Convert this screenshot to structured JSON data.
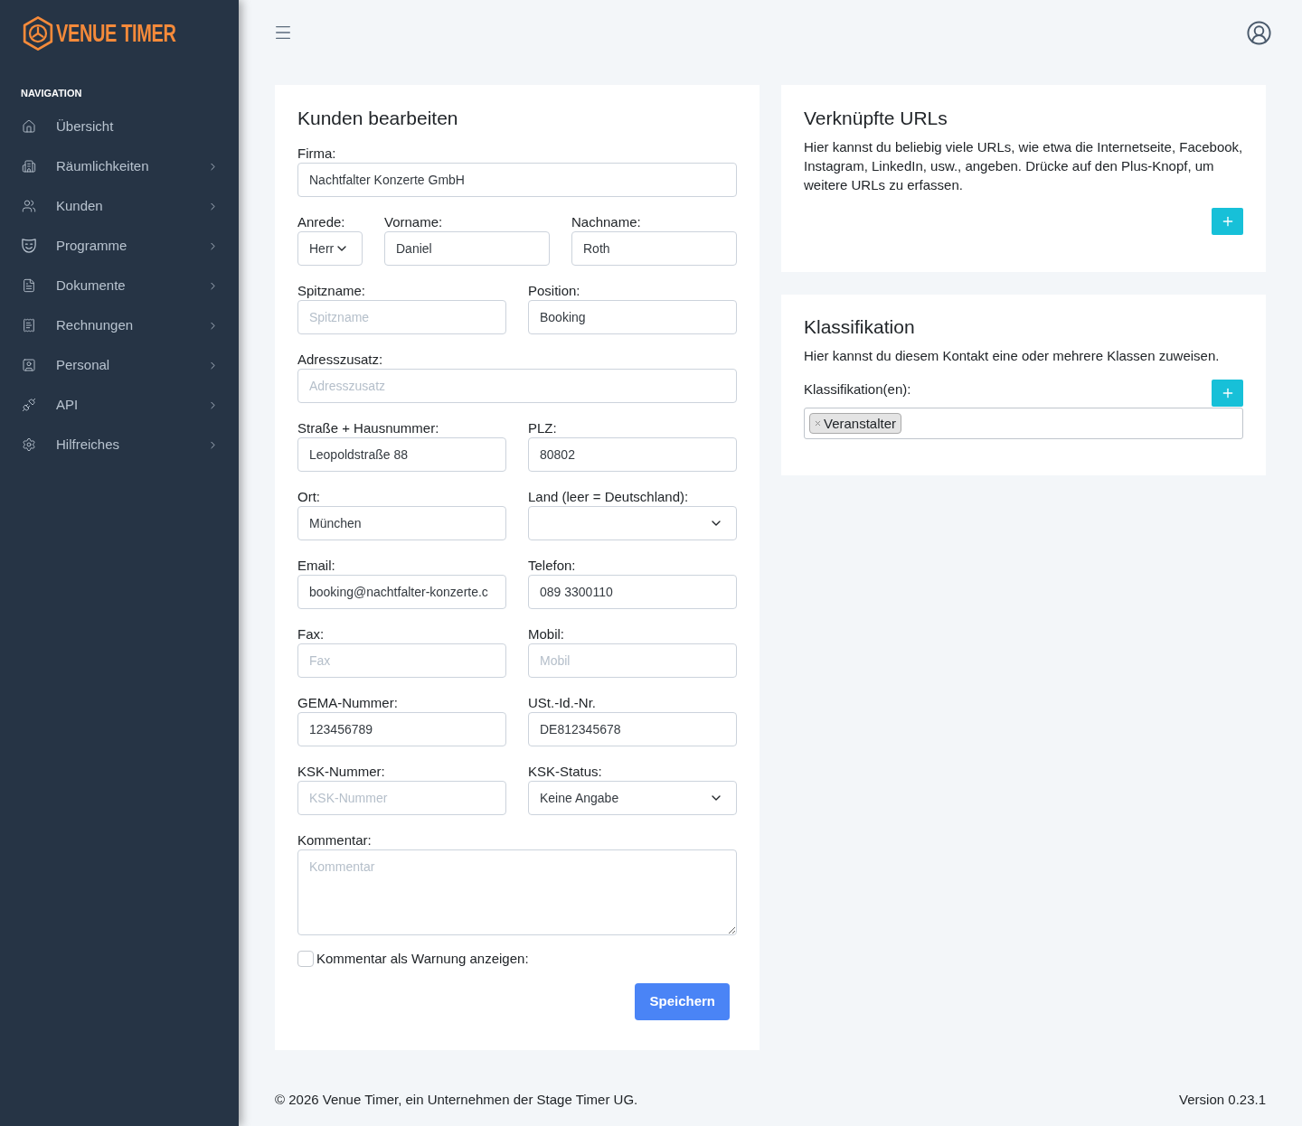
{
  "sidebar": {
    "logo_text": "VENUE TIMER",
    "section_title": "NAVIGATION",
    "items": [
      {
        "label": "Übersicht",
        "has_submenu": false
      },
      {
        "label": "Räumlichkeiten",
        "has_submenu": true
      },
      {
        "label": "Kunden",
        "has_submenu": true
      },
      {
        "label": "Programme",
        "has_submenu": true
      },
      {
        "label": "Dokumente",
        "has_submenu": true
      },
      {
        "label": "Rechnungen",
        "has_submenu": true
      },
      {
        "label": "Personal",
        "has_submenu": true
      },
      {
        "label": "API",
        "has_submenu": true
      },
      {
        "label": "Hilfreiches",
        "has_submenu": true
      }
    ]
  },
  "customer_form": {
    "title": "Kunden bearbeiten",
    "rows": [
      [
        {
          "label": "Firma:",
          "kind": "input",
          "value": "Nachtfalter Konzerte GmbH"
        }
      ],
      [
        {
          "label": "Anrede:",
          "kind": "select",
          "value": "Herr"
        },
        {
          "label": "Vorname:",
          "kind": "input",
          "value": "Daniel"
        },
        {
          "label": "Nachname:",
          "kind": "input",
          "value": "Roth"
        }
      ],
      [
        {
          "label": "Spitzname:",
          "kind": "input",
          "placeholder": "Spitzname"
        },
        {
          "label": "Position:",
          "kind": "input",
          "value": "Booking"
        }
      ],
      [
        {
          "label": "Adresszusatz:",
          "kind": "input",
          "placeholder": "Adresszusatz"
        }
      ],
      [
        {
          "label": "Straße + Hausnummer:",
          "kind": "input",
          "value": "Leopoldstraße 88"
        },
        {
          "label": "PLZ:",
          "kind": "input",
          "value": "80802"
        }
      ],
      [
        {
          "label": "Ort:",
          "kind": "input",
          "value": "München"
        },
        {
          "label": "Land (leer = Deutschland):",
          "kind": "select"
        }
      ],
      [
        {
          "label": "Email:",
          "kind": "input",
          "value": "booking@nachtfalter-konzerte.c"
        },
        {
          "label": "Telefon:",
          "kind": "input",
          "value": "089 3300110"
        }
      ],
      [
        {
          "label": "Fax:",
          "kind": "input",
          "placeholder": "Fax"
        },
        {
          "label": "Mobil:",
          "kind": "input",
          "placeholder": "Mobil"
        }
      ],
      [
        {
          "label": "GEMA-Nummer:",
          "kind": "input",
          "value": "123456789"
        },
        {
          "label": "USt.-Id.-Nr.",
          "kind": "input",
          "value": "DE812345678"
        }
      ],
      [
        {
          "label": "KSK-Nummer:",
          "kind": "input",
          "placeholder": "KSK-Nummer"
        },
        {
          "label": "KSK-Status:",
          "kind": "select",
          "value": "Keine Angabe"
        }
      ],
      [
        {
          "label": "Kommentar:",
          "kind": "textarea",
          "placeholder": "Kommentar"
        }
      ]
    ],
    "warning_checkbox": {
      "label": "Kommentar als Warnung anzeigen:",
      "checked": false
    },
    "save_button": "Speichern"
  },
  "urls_card": {
    "title": "Verknüpfte URLs",
    "description": "Hier kannst du beliebig viele URLs, wie etwa die Internetseite, Facebook, Instagram, LinkedIn, usw., angeben. Drücke auf den Plus-Knopf, um weitere URLs zu erfassen."
  },
  "classification_card": {
    "title": "Klassifikation",
    "description": "Hier kannst du diesem Kontakt eine oder mehrere Klassen zuweisen.",
    "field_label": "Klassifikation(en):",
    "tags": [
      {
        "label": "Veranstalter"
      }
    ]
  },
  "footer": {
    "copyright": "© 2026 Venue Timer, ein Unternehmen der Stage Timer UG.",
    "version": "Version 0.23.1"
  }
}
